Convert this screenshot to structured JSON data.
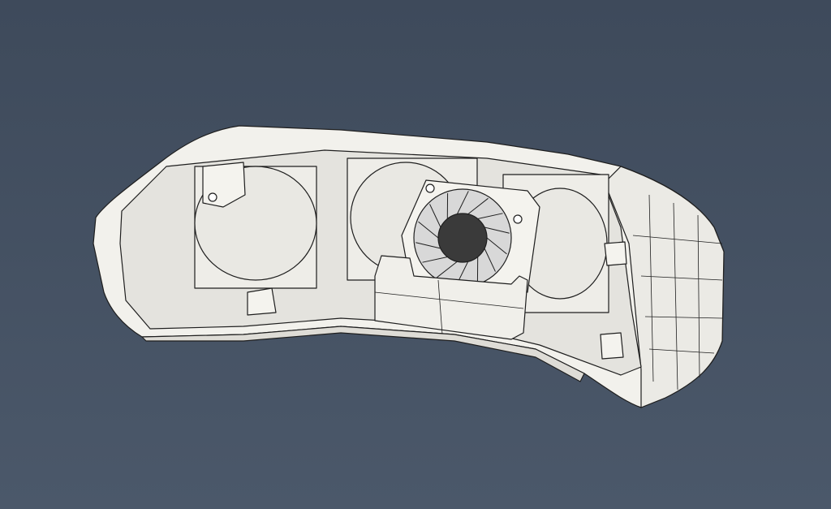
{
  "scene": {
    "subject": "enclosure-with-fan",
    "colors": {
      "background_top": "#3e4a5b",
      "background_bottom": "#4b586a",
      "shell": "#f2f1ec",
      "shell_shadow": "#d9d8d2",
      "cavity": "#e4e3de",
      "edge": "#1e1e1e",
      "fan_hub": "#3a3a3a",
      "fan_blade": "#d8d8d8"
    },
    "icons": [
      "fan-icon",
      "screw-icon"
    ]
  }
}
